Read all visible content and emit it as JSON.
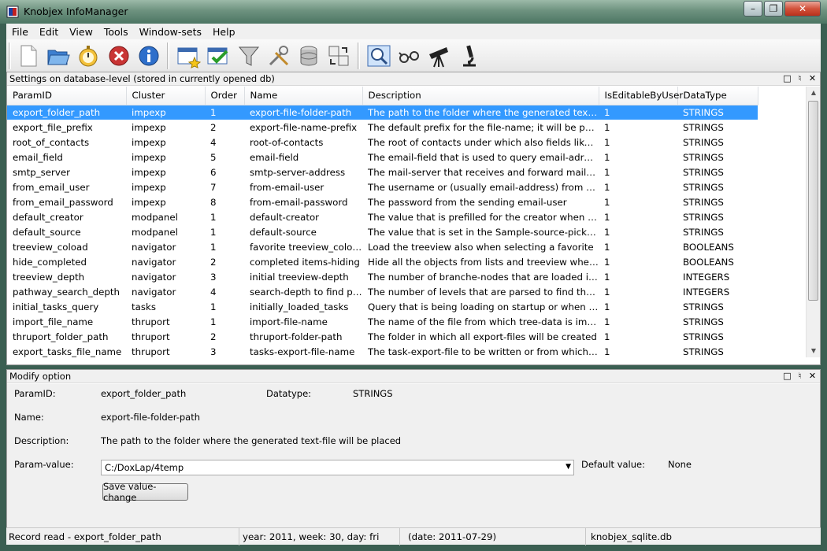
{
  "window": {
    "title": "Knobjex InfoManager"
  },
  "menu": [
    "File",
    "Edit",
    "View",
    "Tools",
    "Window-sets",
    "Help"
  ],
  "toolbar_icons": [
    "new-document-icon",
    "open-folder-icon",
    "stopwatch-icon",
    "stop-icon",
    "info-icon",
    "new-window-icon",
    "checklist-icon",
    "filter-icon",
    "tools-icon",
    "database-icon",
    "transfer-icon",
    "search-icon",
    "glasses-icon",
    "telescope-icon",
    "microscope-icon"
  ],
  "settings_panel": {
    "title": "Settings on database-level (stored in currently opened db)",
    "columns": [
      "ParamID",
      "Cluster",
      "Order",
      "Name",
      "Description",
      "IsEditableByUser",
      "DataType"
    ],
    "rows": [
      [
        "export_folder_path",
        "impexp",
        "1",
        "export-file-folder-path",
        "The path to the folder where the generated text-file ...",
        "1",
        "STRINGS"
      ],
      [
        "export_file_prefix",
        "impexp",
        "2",
        "export-file-name-prefix",
        "The default prefix for the file-name; it will be postfixe...",
        "1",
        "STRINGS"
      ],
      [
        "root_of_contacts",
        "impexp",
        "4",
        "root-of-contacts",
        "The root of contacts under which also fields like addr...",
        "1",
        "STRINGS"
      ],
      [
        "email_field",
        "impexp",
        "5",
        "email-field",
        "The email-field that is used to query email-adresses",
        "1",
        "STRINGS"
      ],
      [
        "smtp_server",
        "impexp",
        "6",
        "smtp-server-address",
        "The mail-server that receives and forward mails to to...",
        "1",
        "STRINGS"
      ],
      [
        "from_email_user",
        "impexp",
        "7",
        "from-email-user",
        "The username or (usually email-address) from which...",
        "1",
        "STRINGS"
      ],
      [
        "from_email_password",
        "impexp",
        "8",
        "from-email-password",
        "The password from the sending email-user",
        "1",
        "STRINGS"
      ],
      [
        "default_creator",
        "modpanel",
        "1",
        "default-creator",
        "The value that is prefilled for the creator when a new ...",
        "1",
        "STRINGS"
      ],
      [
        "default_source",
        "modpanel",
        "1",
        "default-source",
        "The value that is set in the Sample-source-picklist fro...",
        "1",
        "STRINGS"
      ],
      [
        "treeview_coload",
        "navigator",
        "1",
        "favorite treeview_coload",
        "Load the treeview also when selecting a favorite",
        "1",
        "BOOLEANS"
      ],
      [
        "hide_completed",
        "navigator",
        "2",
        "completed items-hiding",
        "Hide all the objects from lists and treeview where the...",
        "1",
        "BOOLEANS"
      ],
      [
        "treeview_depth",
        "navigator",
        "3",
        "initial treeview-depth",
        "The number of branche-nodes that are loaded in the...",
        "1",
        "INTEGERS"
      ],
      [
        "pathway_search_depth",
        "navigator",
        "4",
        "search-depth to find pat...",
        "The number of levels that are parsed to find the targ...",
        "1",
        "INTEGERS"
      ],
      [
        "initial_tasks_query",
        "tasks",
        "1",
        "initially_loaded_tasks",
        "Query that is being loading on startup or when no q...",
        "1",
        "STRINGS"
      ],
      [
        "import_file_name",
        "thruport",
        "1",
        "import-file-name",
        "The name of the file from which tree-data is importe...",
        "1",
        "STRINGS"
      ],
      [
        "thruport_folder_path",
        "thruport",
        "2",
        "thruport-folder-path",
        "The folder in which all export-files will be created",
        "1",
        "STRINGS"
      ],
      [
        "export_tasks_file_name",
        "thruport",
        "3",
        "tasks-export-file-name",
        "The task-export-file to be written or from which cha...",
        "1",
        "STRINGS"
      ]
    ]
  },
  "modify_panel": {
    "title": "Modify option",
    "paramid_label": "ParamID:",
    "paramid_value": "export_folder_path",
    "datatype_label": "Datatype:",
    "datatype_value": "STRINGS",
    "name_label": "Name:",
    "name_value": "export-file-folder-path",
    "description_label": "Description:",
    "description_value": "The path to the folder where the generated text-file will be placed",
    "paramvalue_label": "Param-value:",
    "paramvalue_value": "C:/DoxLap/4temp",
    "default_label": "Default value:",
    "default_value": "None",
    "save_button": "Save value-change"
  },
  "statusbar": {
    "record": "Record read - export_folder_path",
    "date_info": "year: 2011,    week: 30,    day: fri",
    "date": "(date: 2011-07-29)",
    "db": "knobjex_sqlite.db"
  },
  "colors": {
    "selection": "#3399ff",
    "panel_bg": "#f0f0f0"
  }
}
